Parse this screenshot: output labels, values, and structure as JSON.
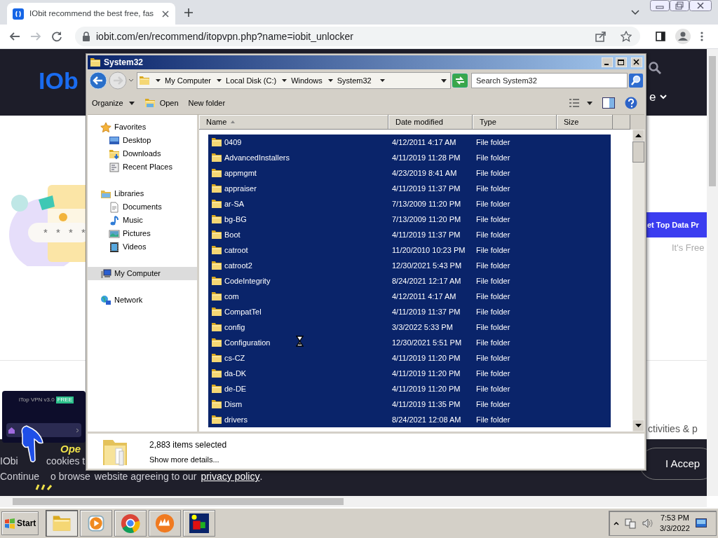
{
  "browser": {
    "tab": {
      "title": "IObit recommend the best free, fas"
    },
    "url": "iobit.com/en/recommend/itopvpn.php?name=iobit_unlocker"
  },
  "page": {
    "logo": "IOb",
    "nav_partial": "e",
    "illustration_mask": "* * * *",
    "promo_button": "et Top Data Pr",
    "promo_note": "It's Free",
    "heading_partial": "ctivities & p",
    "ad": {
      "title": "iTop VPN v3.0",
      "badge": "FREE",
      "caption": "Ope"
    },
    "cookie": {
      "line1": [
        "IObi",
        "cookies t"
      ],
      "line2": [
        "Continue",
        "o browse",
        "website agreeing to our"
      ],
      "link": "privacy policy",
      "end": ".",
      "accept": "I Accep"
    }
  },
  "explorer": {
    "title": "System32",
    "breadcrumb": [
      "My Computer",
      "Local Disk (C:)",
      "Windows",
      "System32"
    ],
    "search": {
      "placeholder": "Search System32"
    },
    "toolbar": [
      {
        "label": "Organize",
        "kind": "menu"
      },
      {
        "label": "Open",
        "kind": "open"
      },
      {
        "label": "New folder",
        "kind": "plain"
      }
    ],
    "nav": [
      {
        "label": "Favorites",
        "selected": false,
        "children": [
          {
            "label": "Desktop",
            "selected": false
          },
          {
            "label": "Downloads",
            "selected": false
          },
          {
            "label": "Recent Places",
            "selected": false
          }
        ]
      },
      {
        "label": "Libraries",
        "selected": false,
        "children": [
          {
            "label": "Documents",
            "selected": false
          },
          {
            "label": "Music",
            "selected": false
          },
          {
            "label": "Pictures",
            "selected": false
          },
          {
            "label": "Videos",
            "selected": false
          }
        ]
      },
      {
        "label": "My Computer",
        "selected": true
      },
      {
        "label": "Network",
        "selected": false
      }
    ],
    "columns": [
      "Name",
      "Date modified",
      "Type",
      "Size"
    ],
    "rows": [
      {
        "name": "0409",
        "date": "4/12/2011 4:17 AM",
        "type": "File folder",
        "selected": true
      },
      {
        "name": "AdvancedInstallers",
        "date": "4/11/2019 11:28 PM",
        "type": "File folder",
        "selected": true
      },
      {
        "name": "appmgmt",
        "date": "4/23/2019 8:41 AM",
        "type": "File folder",
        "selected": true
      },
      {
        "name": "appraiser",
        "date": "4/11/2019 11:37 PM",
        "type": "File folder",
        "selected": true
      },
      {
        "name": "ar-SA",
        "date": "7/13/2009 11:20 PM",
        "type": "File folder",
        "selected": true
      },
      {
        "name": "bg-BG",
        "date": "7/13/2009 11:20 PM",
        "type": "File folder",
        "selected": true
      },
      {
        "name": "Boot",
        "date": "4/11/2019 11:37 PM",
        "type": "File folder",
        "selected": true
      },
      {
        "name": "catroot",
        "date": "11/20/2010 10:23 PM",
        "type": "File folder",
        "selected": true
      },
      {
        "name": "catroot2",
        "date": "12/30/2021 5:43 PM",
        "type": "File folder",
        "selected": true
      },
      {
        "name": "CodeIntegrity",
        "date": "8/24/2021 12:17 AM",
        "type": "File folder",
        "selected": true
      },
      {
        "name": "com",
        "date": "4/12/2011 4:17 AM",
        "type": "File folder",
        "selected": true
      },
      {
        "name": "CompatTel",
        "date": "4/11/2019 11:37 PM",
        "type": "File folder",
        "selected": true
      },
      {
        "name": "config",
        "date": "3/3/2022 5:33 PM",
        "type": "File folder",
        "selected": true
      },
      {
        "name": "Configuration",
        "date": "12/30/2021 5:51 PM",
        "type": "File folder",
        "selected": true
      },
      {
        "name": "cs-CZ",
        "date": "4/11/2019 11:20 PM",
        "type": "File folder",
        "selected": true
      },
      {
        "name": "da-DK",
        "date": "4/11/2019 11:20 PM",
        "type": "File folder",
        "selected": true
      },
      {
        "name": "de-DE",
        "date": "4/11/2019 11:20 PM",
        "type": "File folder",
        "selected": true
      },
      {
        "name": "Dism",
        "date": "4/11/2019 11:35 PM",
        "type": "File folder",
        "selected": true
      },
      {
        "name": "drivers",
        "date": "8/24/2021 12:08 AM",
        "type": "File folder",
        "selected": true
      }
    ],
    "details": {
      "count": "2,883 items selected",
      "link": "Show more details..."
    }
  },
  "taskbar": {
    "start": "Start",
    "apps": [
      {
        "selected": true
      },
      {
        "selected": false
      },
      {
        "selected": false
      },
      {
        "selected": false
      },
      {
        "selected": false
      }
    ],
    "time": "7:53 PM",
    "date": "3/3/2022"
  }
}
